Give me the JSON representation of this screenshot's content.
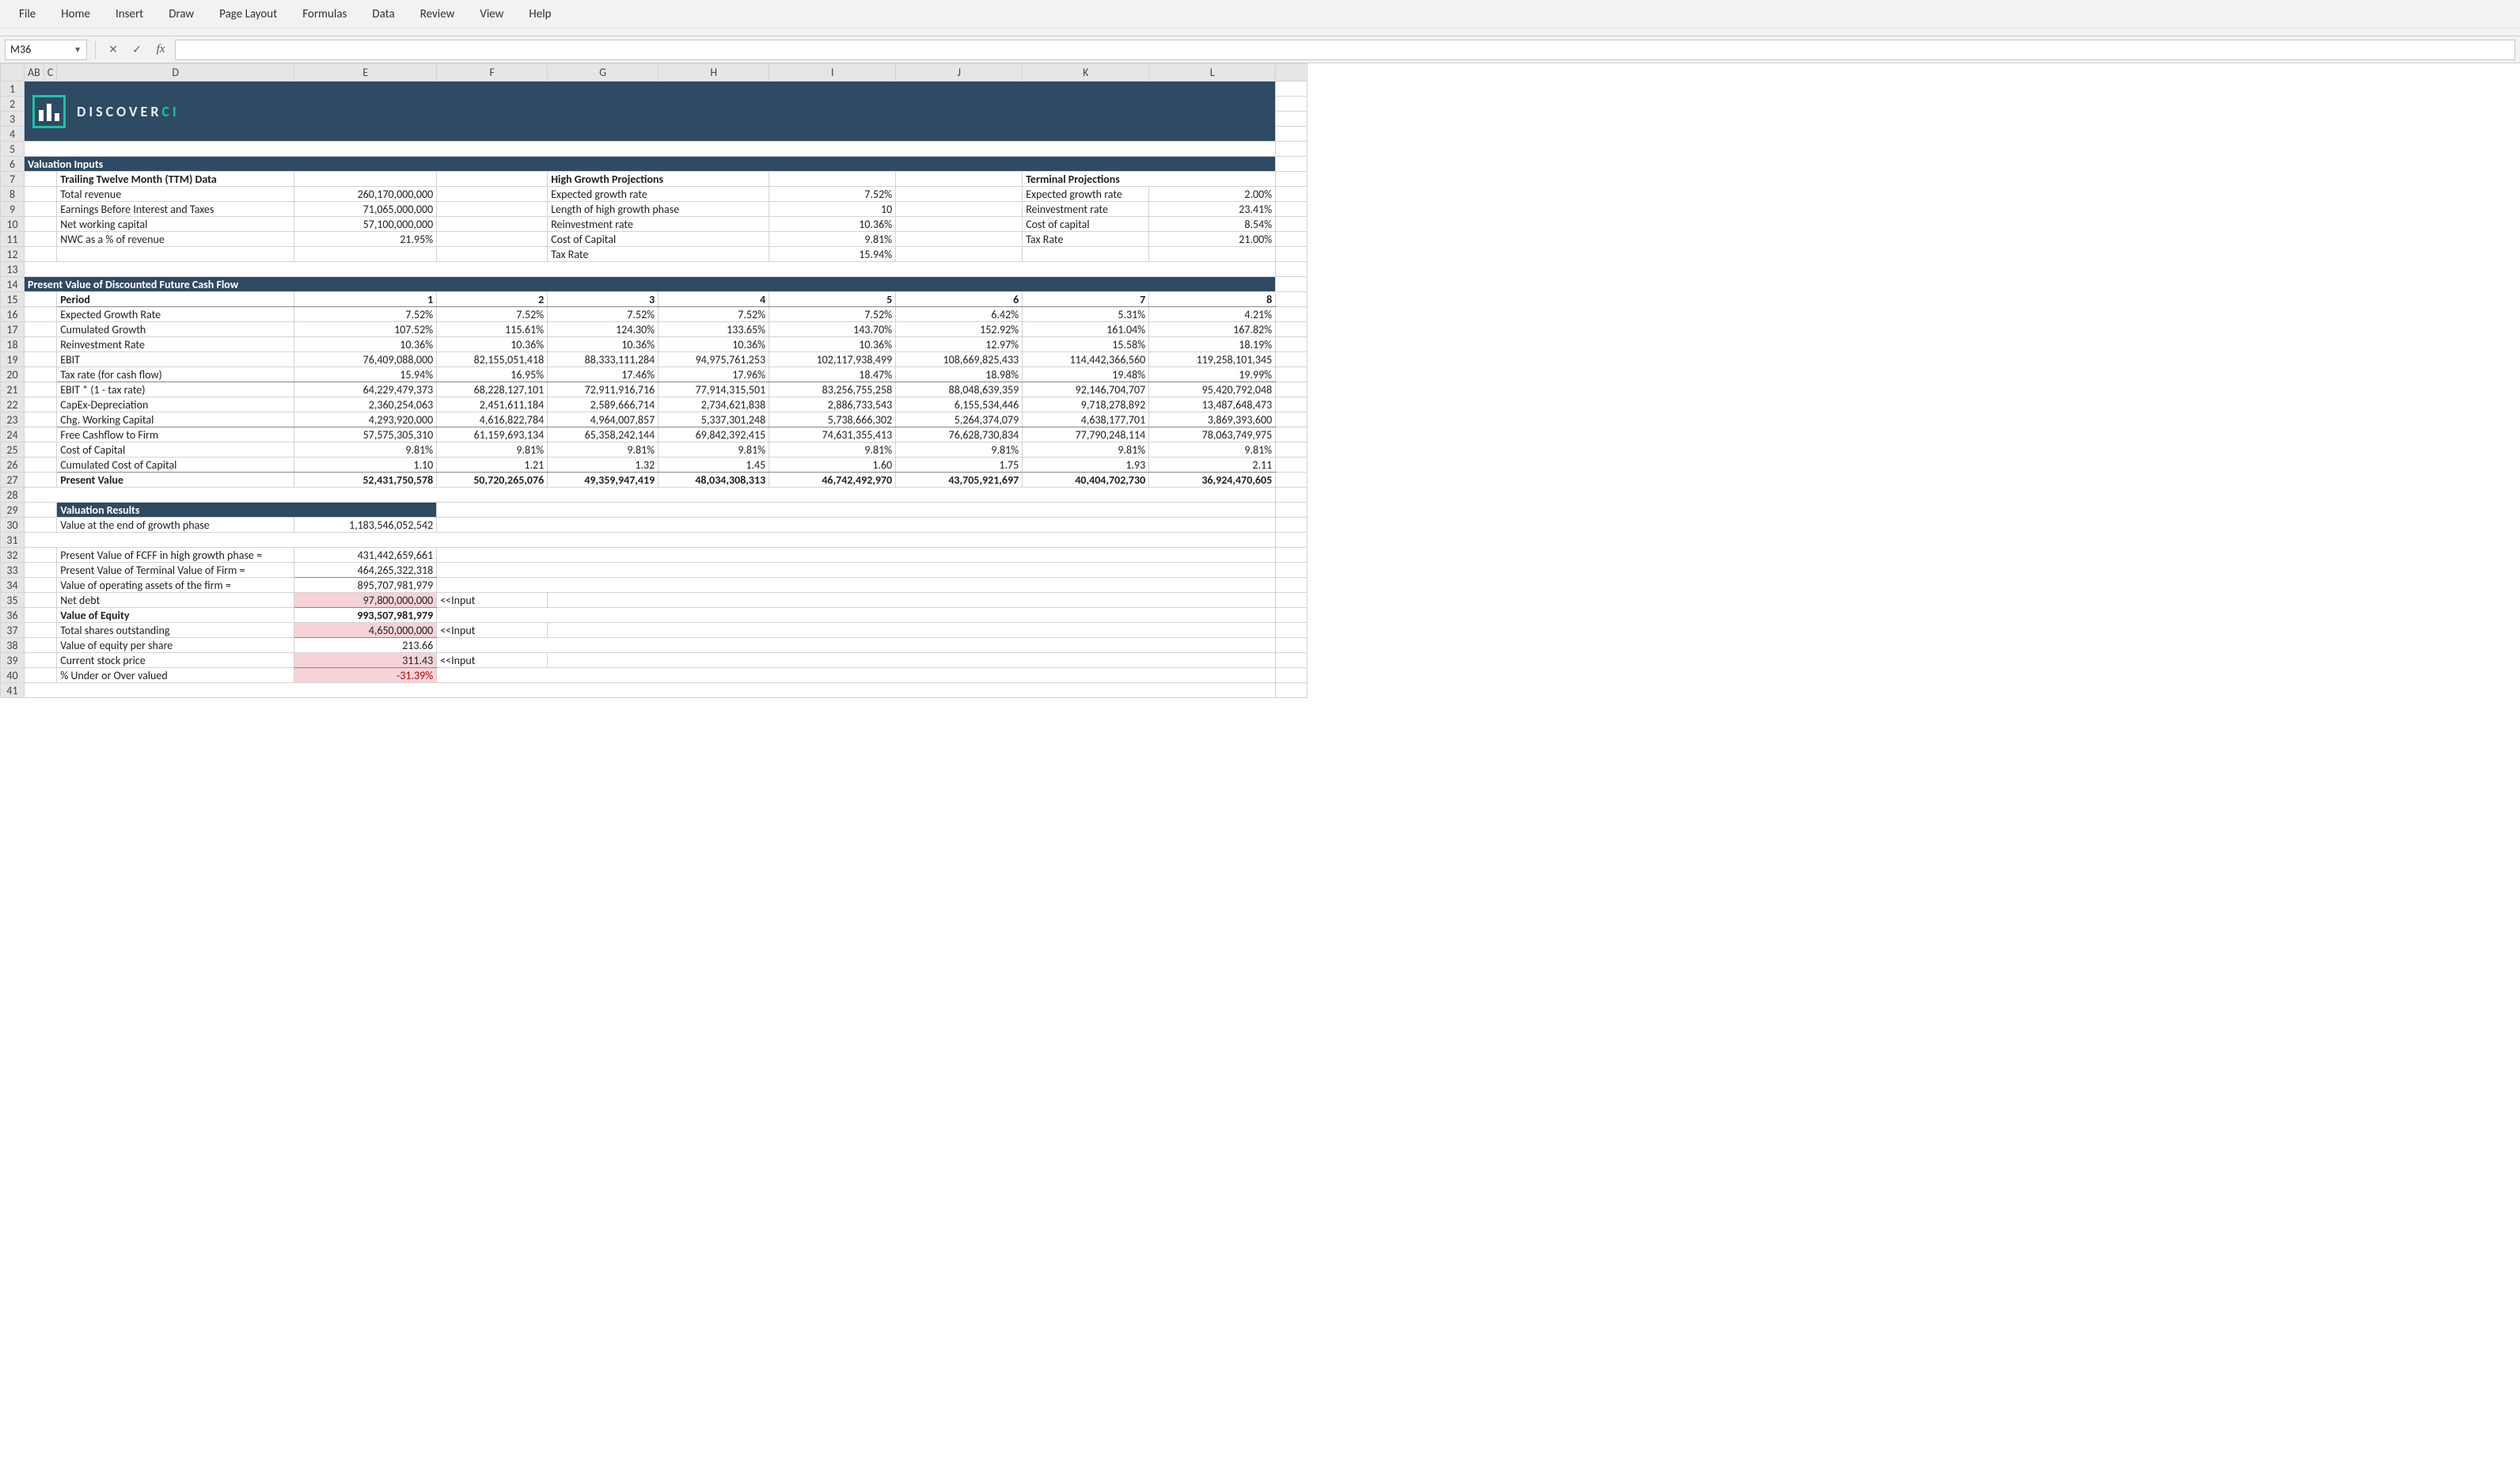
{
  "ribbon": {
    "tabs": [
      "File",
      "Home",
      "Insert",
      "Draw",
      "Page Layout",
      "Formulas",
      "Data",
      "Review",
      "View",
      "Help"
    ]
  },
  "namebox": "M36",
  "fx_label": "fx",
  "formula_value": "",
  "col_headers": [
    "A",
    "B",
    "C",
    "D",
    "E",
    "F",
    "G",
    "H",
    "I",
    "J",
    "K",
    "L"
  ],
  "row_headers": [
    "1",
    "2",
    "3",
    "4",
    "5",
    "6",
    "7",
    "8",
    "9",
    "10",
    "11",
    "12",
    "13",
    "14",
    "15",
    "16",
    "17",
    "18",
    "19",
    "20",
    "21",
    "22",
    "23",
    "24",
    "25",
    "26",
    "27",
    "28",
    "29",
    "30",
    "31",
    "32",
    "33",
    "34",
    "35",
    "36",
    "37",
    "38",
    "39",
    "40",
    "41"
  ],
  "logo": {
    "brand_a": "DISCOVER",
    "brand_b": "CI"
  },
  "sections": {
    "valuation_inputs": "Valuation Inputs",
    "pv_dcf": "Present Value of Discounted Future Cash Flow",
    "valuation_results": "Valuation Results"
  },
  "headers": {
    "ttm": "Trailing Twelve Month (TTM) Data",
    "hgp": "High Growth Projections",
    "tp": "Terminal Projections",
    "period": "Period"
  },
  "ttm": {
    "total_revenue_lbl": "Total revenue",
    "total_revenue": "260,170,000,000",
    "ebit_lbl": "Earnings Before Interest and Taxes",
    "ebit": "71,065,000,000",
    "nwc_lbl": "Net working capital",
    "nwc": "57,100,000,000",
    "nwc_pct_lbl": "NWC as a % of revenue",
    "nwc_pct": "21.95%"
  },
  "hgp": {
    "egr_lbl": "Expected growth rate",
    "egr": "7.52%",
    "len_lbl": "Length of high growth phase",
    "len": "10",
    "rr_lbl": "Reinvestment rate",
    "rr": "10.36%",
    "coc_lbl": "Cost of Capital",
    "coc": "9.81%",
    "tax_lbl": "Tax Rate",
    "tax": "15.94%"
  },
  "tp": {
    "egr_lbl": "Expected growth rate",
    "egr": "2.00%",
    "rr_lbl": "Reinvestment rate",
    "rr": "23.41%",
    "coc_lbl": "Cost of capital",
    "coc": "8.54%",
    "tax_lbl": "Tax Rate",
    "tax": "21.00%"
  },
  "periods": [
    "1",
    "2",
    "3",
    "4",
    "5",
    "6",
    "7",
    "8"
  ],
  "dcf": {
    "egr": {
      "lbl": "Expected Growth Rate",
      "v": [
        "7.52%",
        "7.52%",
        "7.52%",
        "7.52%",
        "7.52%",
        "6.42%",
        "5.31%",
        "4.21%"
      ]
    },
    "cumg": {
      "lbl": "Cumulated Growth",
      "v": [
        "107.52%",
        "115.61%",
        "124.30%",
        "133.65%",
        "143.70%",
        "152.92%",
        "161.04%",
        "167.82%"
      ]
    },
    "rr": {
      "lbl": "Reinvestment Rate",
      "v": [
        "10.36%",
        "10.36%",
        "10.36%",
        "10.36%",
        "10.36%",
        "12.97%",
        "15.58%",
        "18.19%"
      ]
    },
    "ebit": {
      "lbl": "EBIT",
      "v": [
        "76,409,088,000",
        "82,155,051,418",
        "88,333,111,284",
        "94,975,761,253",
        "102,117,938,499",
        "108,669,825,433",
        "114,442,366,560",
        "119,258,101,345"
      ]
    },
    "tax": {
      "lbl": "Tax rate (for cash flow)",
      "v": [
        "15.94%",
        "16.95%",
        "17.46%",
        "17.96%",
        "18.47%",
        "18.98%",
        "19.48%",
        "19.99%"
      ]
    },
    "ebit1t": {
      "lbl": "EBIT * (1 - tax rate)",
      "v": [
        "64,229,479,373",
        "68,228,127,101",
        "72,911,916,716",
        "77,914,315,501",
        "83,256,755,258",
        "88,048,639,359",
        "92,146,704,707",
        "95,420,792,048"
      ]
    },
    "capex": {
      "lbl": "CapEx-Depreciation",
      "v": [
        "2,360,254,063",
        "2,451,611,184",
        "2,589,666,714",
        "2,734,621,838",
        "2,886,733,543",
        "6,155,534,446",
        "9,718,278,892",
        "13,487,648,473"
      ]
    },
    "chgwc": {
      "lbl": "Chg. Working Capital",
      "v": [
        "4,293,920,000",
        "4,616,822,784",
        "4,964,007,857",
        "5,337,301,248",
        "5,738,666,302",
        "5,264,374,079",
        "4,638,177,701",
        "3,869,393,600"
      ]
    },
    "fcff": {
      "lbl": "Free Cashflow to Firm",
      "v": [
        "57,575,305,310",
        "61,159,693,134",
        "65,358,242,144",
        "69,842,392,415",
        "74,631,355,413",
        "76,628,730,834",
        "77,790,248,114",
        "78,063,749,975"
      ]
    },
    "coc": {
      "lbl": "Cost of Capital",
      "v": [
        "9.81%",
        "9.81%",
        "9.81%",
        "9.81%",
        "9.81%",
        "9.81%",
        "9.81%",
        "9.81%"
      ]
    },
    "cumcoc": {
      "lbl": "Cumulated Cost of Capital",
      "v": [
        "1.10",
        "1.21",
        "1.32",
        "1.45",
        "1.60",
        "1.75",
        "1.93",
        "2.11"
      ]
    },
    "pv": {
      "lbl": "Present Value",
      "v": [
        "52,431,750,578",
        "50,720,265,076",
        "49,359,947,419",
        "48,034,308,313",
        "46,742,492,970",
        "43,705,921,697",
        "40,404,702,730",
        "36,924,470,605"
      ]
    }
  },
  "results": {
    "end_val_lbl": "Value at the end of growth phase",
    "end_val": "1,183,546,052,542",
    "pv_fcff_lbl": "Present Value of FCFF in high growth phase =",
    "pv_fcff": "431,442,659,661",
    "pv_tv_lbl": "Present Value of Terminal Value of Firm =",
    "pv_tv": "464,265,322,318",
    "op_assets_lbl": "Value of operating assets of the firm =",
    "op_assets": "895,707,981,979",
    "net_debt_lbl": "Net debt",
    "net_debt": "97,800,000,000",
    "net_debt_note": "<<Input",
    "voe_lbl": "Value of Equity",
    "voe": "993,507,981,979",
    "shares_lbl": "Total shares outstanding",
    "shares": "4,650,000,000",
    "shares_note": "<<Input",
    "voeps_lbl": "Value of equity per share",
    "voeps": "213.66",
    "price_lbl": "Current stock price",
    "price": "311.43",
    "price_note": "<<Input",
    "pct_lbl": "% Under or Over valued",
    "pct": "-31.39%"
  }
}
